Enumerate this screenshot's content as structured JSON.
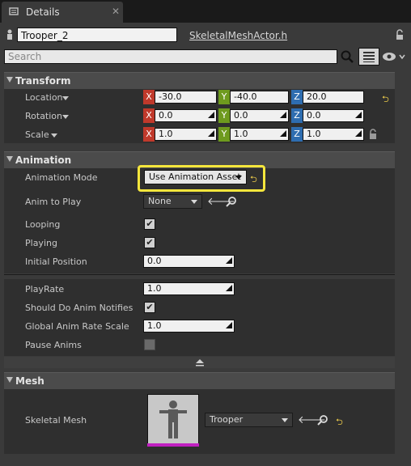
{
  "tab": {
    "title": "Details",
    "close": "✕"
  },
  "header": {
    "actor_name": "Trooper_2",
    "class_link": "SkeletalMeshActor.h",
    "search_placeholder": "Search"
  },
  "axis_labels": {
    "x": "X",
    "y": "Y",
    "z": "Z"
  },
  "sections": {
    "transform": {
      "title": "Transform",
      "location": {
        "label": "Location",
        "x": "-30.0",
        "y": "-40.0",
        "z": "20.0"
      },
      "rotation": {
        "label": "Rotation",
        "x": "0.0",
        "y": "0.0",
        "z": "0.0"
      },
      "scale": {
        "label": "Scale",
        "x": "1.0",
        "y": "1.0",
        "z": "1.0"
      }
    },
    "animation": {
      "title": "Animation",
      "animation_mode": {
        "label": "Animation Mode",
        "value": "Use Animation Asset"
      },
      "anim_to_play": {
        "label": "Anim to Play",
        "value": "None"
      },
      "looping": {
        "label": "Looping",
        "checked": true
      },
      "playing": {
        "label": "Playing",
        "checked": true
      },
      "initial_position": {
        "label": "Initial Position",
        "value": "0.0"
      },
      "play_rate": {
        "label": "PlayRate",
        "value": "1.0"
      },
      "should_do_anim_notifies": {
        "label": "Should Do Anim Notifies",
        "checked": true
      },
      "global_anim_rate_scale": {
        "label": "Global Anim Rate Scale",
        "value": "1.0"
      },
      "pause_anims": {
        "label": "Pause Anims",
        "checked": false
      }
    },
    "mesh": {
      "title": "Mesh",
      "skeletal_mesh": {
        "label": "Skeletal Mesh",
        "value": "Trooper"
      }
    }
  },
  "icons": {
    "actor": "actor-icon",
    "lock": "lock-icon",
    "search": "magnifier-icon",
    "view_options": "view-options-icon",
    "eye": "eye-icon",
    "reset": "reset-to-default-icon",
    "use_selected": "arrow-left-icon",
    "browse": "browse-icon"
  },
  "colors": {
    "axis_x": "#c0392b",
    "axis_y": "#6e9a1e",
    "axis_z": "#2e6db0",
    "highlight": "#f5e63c",
    "thumb_bar": "#c020c0"
  }
}
